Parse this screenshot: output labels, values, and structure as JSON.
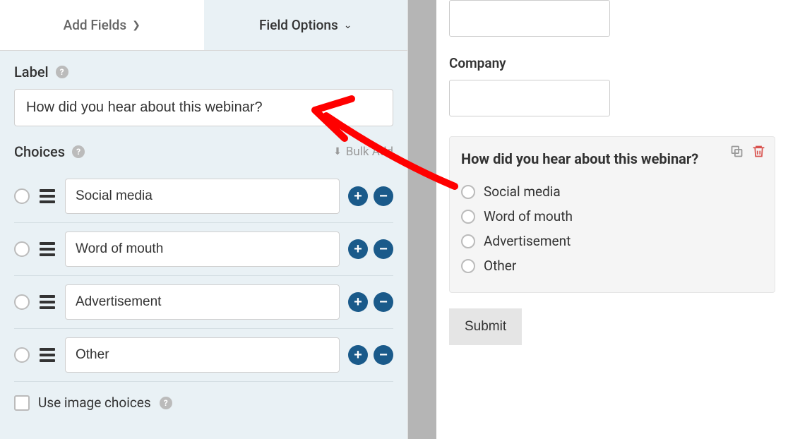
{
  "tabs": {
    "add_fields": "Add Fields",
    "field_options": "Field Options"
  },
  "label_section": {
    "heading": "Label",
    "value": "How did you hear about this webinar?"
  },
  "choices_section": {
    "heading": "Choices",
    "bulk_add": "Bulk Add",
    "items": [
      "Social media",
      "Word of mouth",
      "Advertisement",
      "Other"
    ]
  },
  "image_choices": {
    "label": "Use image choices"
  },
  "preview": {
    "company_label": "Company",
    "question": "How did you hear about this webinar?",
    "options": [
      "Social media",
      "Word of mouth",
      "Advertisement",
      "Other"
    ],
    "submit": "Submit"
  }
}
